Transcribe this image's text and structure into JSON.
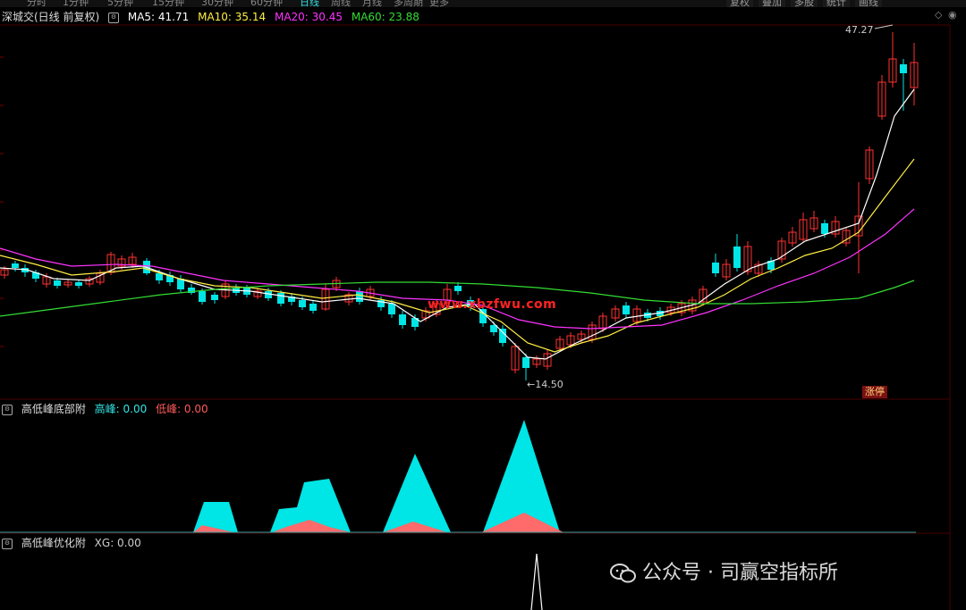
{
  "top_tabs": [
    "分时",
    "1分钟",
    "5分钟",
    "15分钟",
    "30分钟",
    "60分钟",
    "日线",
    "周线",
    "月线",
    "多周期",
    "更多"
  ],
  "right_tabs": [
    "复权",
    "叠加",
    "多股",
    "统计",
    "画线"
  ],
  "main": {
    "stock": "深城交(日线 前复权)",
    "ma": [
      {
        "label": "MA5: 41.71",
        "color": "#ffffff"
      },
      {
        "label": "MA10: 35.14",
        "color": "#ffee44"
      },
      {
        "label": "MA20: 30.45",
        "color": "#ff33ff"
      },
      {
        "label": "MA60: 23.88",
        "color": "#33dd33"
      }
    ],
    "high_label": "47.27",
    "low_label": "←14.50",
    "watermark_site": "www.xbzfwu.com",
    "badge": "涨停"
  },
  "panel1": {
    "title": "高低峰底部附",
    "items": [
      {
        "label": "高峰: 0.00",
        "color": "#33e5e5"
      },
      {
        "label": "低峰: 0.00",
        "color": "#ff5a5a"
      }
    ]
  },
  "panel2": {
    "title": "高低峰优化附",
    "items": [
      {
        "label": "XG: 0.00",
        "color": "#cccccc"
      }
    ]
  },
  "footer_watermark": "公众号 · 司赢空指标所",
  "colors": {
    "up": "#ff3232",
    "down": "#00e5e5",
    "bg": "#000000",
    "frame": "#5a0000"
  }
}
